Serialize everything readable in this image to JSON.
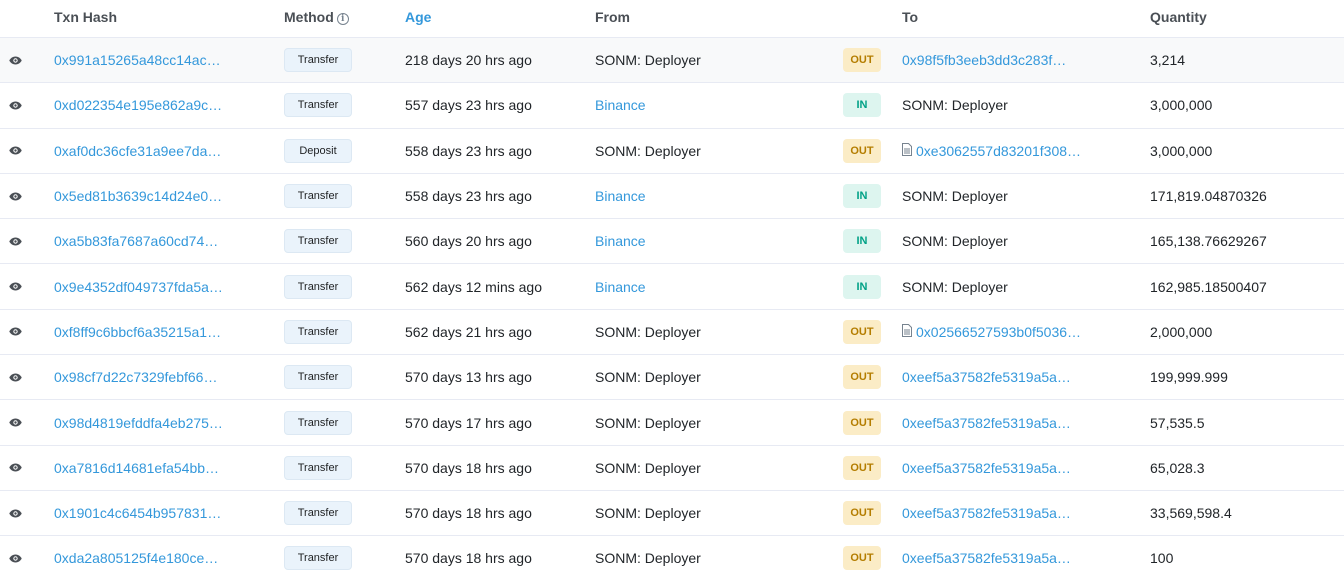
{
  "headers": {
    "txn_hash": "Txn Hash",
    "method": "Method",
    "age": "Age",
    "from": "From",
    "to": "To",
    "quantity": "Quantity"
  },
  "rows": [
    {
      "hash": "0x991a15265a48cc14ac…",
      "method": "Transfer",
      "age": "218 days 20 hrs ago",
      "from": "SONM: Deployer",
      "from_link": false,
      "dir": "OUT",
      "to": "0x98f5fb3eeb3dd3c283f…",
      "to_link": true,
      "to_contract": false,
      "qty": "3,214"
    },
    {
      "hash": "0xd022354e195e862a9c…",
      "method": "Transfer",
      "age": "557 days 23 hrs ago",
      "from": "Binance",
      "from_link": true,
      "dir": "IN",
      "to": "SONM: Deployer",
      "to_link": false,
      "to_contract": false,
      "qty": "3,000,000"
    },
    {
      "hash": "0xaf0dc36cfe31a9ee7da…",
      "method": "Deposit",
      "age": "558 days 23 hrs ago",
      "from": "SONM: Deployer",
      "from_link": false,
      "dir": "OUT",
      "to": "0xe3062557d83201f308…",
      "to_link": true,
      "to_contract": true,
      "qty": "3,000,000"
    },
    {
      "hash": "0x5ed81b3639c14d24e0…",
      "method": "Transfer",
      "age": "558 days 23 hrs ago",
      "from": "Binance",
      "from_link": true,
      "dir": "IN",
      "to": "SONM: Deployer",
      "to_link": false,
      "to_contract": false,
      "qty": "171,819.04870326"
    },
    {
      "hash": "0xa5b83fa7687a60cd74…",
      "method": "Transfer",
      "age": "560 days 20 hrs ago",
      "from": "Binance",
      "from_link": true,
      "dir": "IN",
      "to": "SONM: Deployer",
      "to_link": false,
      "to_contract": false,
      "qty": "165,138.76629267"
    },
    {
      "hash": "0x9e4352df049737fda5a…",
      "method": "Transfer",
      "age": "562 days 12 mins ago",
      "from": "Binance",
      "from_link": true,
      "dir": "IN",
      "to": "SONM: Deployer",
      "to_link": false,
      "to_contract": false,
      "qty": "162,985.18500407"
    },
    {
      "hash": "0xf8ff9c6bbcf6a35215a1…",
      "method": "Transfer",
      "age": "562 days 21 hrs ago",
      "from": "SONM: Deployer",
      "from_link": false,
      "dir": "OUT",
      "to": "0x02566527593b0f5036…",
      "to_link": true,
      "to_contract": true,
      "qty": "2,000,000"
    },
    {
      "hash": "0x98cf7d22c7329febf66…",
      "method": "Transfer",
      "age": "570 days 13 hrs ago",
      "from": "SONM: Deployer",
      "from_link": false,
      "dir": "OUT",
      "to": "0xeef5a37582fe5319a5a…",
      "to_link": true,
      "to_contract": false,
      "qty": "199,999.999"
    },
    {
      "hash": "0x98d4819efddfa4eb275…",
      "method": "Transfer",
      "age": "570 days 17 hrs ago",
      "from": "SONM: Deployer",
      "from_link": false,
      "dir": "OUT",
      "to": "0xeef5a37582fe5319a5a…",
      "to_link": true,
      "to_contract": false,
      "qty": "57,535.5"
    },
    {
      "hash": "0xa7816d14681efa54bb…",
      "method": "Transfer",
      "age": "570 days 18 hrs ago",
      "from": "SONM: Deployer",
      "from_link": false,
      "dir": "OUT",
      "to": "0xeef5a37582fe5319a5a…",
      "to_link": true,
      "to_contract": false,
      "qty": "65,028.3"
    },
    {
      "hash": "0x1901c4c6454b957831…",
      "method": "Transfer",
      "age": "570 days 18 hrs ago",
      "from": "SONM: Deployer",
      "from_link": false,
      "dir": "OUT",
      "to": "0xeef5a37582fe5319a5a…",
      "to_link": true,
      "to_contract": false,
      "qty": "33,569,598.4"
    },
    {
      "hash": "0xda2a805125f4e180ce…",
      "method": "Transfer",
      "age": "570 days 18 hrs ago",
      "from": "SONM: Deployer",
      "from_link": false,
      "dir": "OUT",
      "to": "0xeef5a37582fe5319a5a…",
      "to_link": true,
      "to_contract": false,
      "qty": "100"
    }
  ]
}
